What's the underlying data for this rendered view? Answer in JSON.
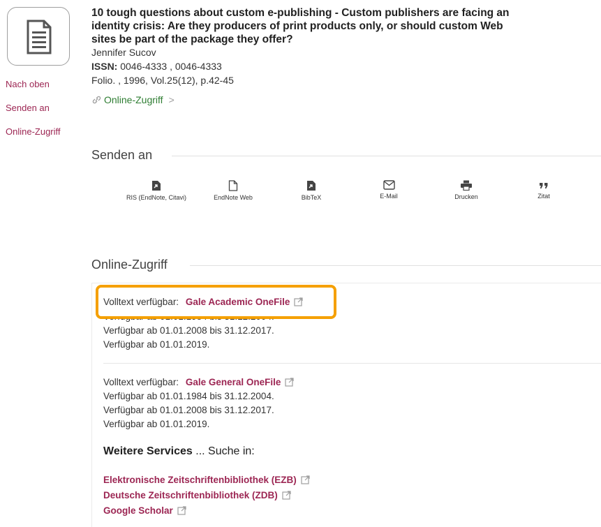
{
  "record": {
    "title": "10 tough questions about custom e-publishing - Custom publishers are facing an identity crisis: Are they producers of print products only, or should custom Web sites be part of the package they offer?",
    "author": "Jennifer Sucov",
    "issn_label": "ISSN:",
    "issn_value": " 0046-4333 , 0046-4333",
    "source": "Folio. , 1996, Vol.25(12), p.42-45",
    "online_link": "Online-Zugriff",
    "chevron": ">"
  },
  "sidenav": [
    {
      "label": "Nach oben"
    },
    {
      "label": "Senden an"
    },
    {
      "label": "Online-Zugriff"
    }
  ],
  "send": {
    "title": "Senden an",
    "buttons": [
      {
        "label": "RIS (EndNote, Citavi)",
        "icon": "ris-file-icon"
      },
      {
        "label": "EndNote Web",
        "icon": "file-icon"
      },
      {
        "label": "BibTeX",
        "icon": "bibtex-file-icon"
      },
      {
        "label": "E-Mail",
        "icon": "mail-icon"
      },
      {
        "label": "Drucken",
        "icon": "printer-icon"
      },
      {
        "label": "Zitat",
        "icon": "quote-icon"
      }
    ]
  },
  "online": {
    "title": "Online-Zugriff",
    "entries": [
      {
        "prefix": "Volltext verfügbar:",
        "provider": "Gale Academic OneFile",
        "lines": [
          "Verfügbar ab 01.01.1984 bis 31.12.2004.",
          "Verfügbar ab 01.01.2008 bis 31.12.2017.",
          "Verfügbar ab 01.01.2019."
        ]
      },
      {
        "prefix": "Volltext verfügbar:",
        "provider": "Gale General OneFile",
        "lines": [
          "Verfügbar ab 01.01.1984 bis 31.12.2004.",
          "Verfügbar ab 01.01.2008 bis 31.12.2017.",
          "Verfügbar ab 01.01.2019."
        ]
      }
    ],
    "more_services_bold": "Weitere Services",
    "more_services_rest": " ... Suche in:",
    "services": [
      {
        "label": "Elektronische Zeitschriftenbibliothek (EZB)"
      },
      {
        "label": "Deutsche Zeitschriftenbibliothek (ZDB)"
      },
      {
        "label": "Google Scholar"
      }
    ]
  },
  "colors": {
    "accent": "#9c2653",
    "link_green": "#2e7d32",
    "highlight": "#f5a000"
  }
}
